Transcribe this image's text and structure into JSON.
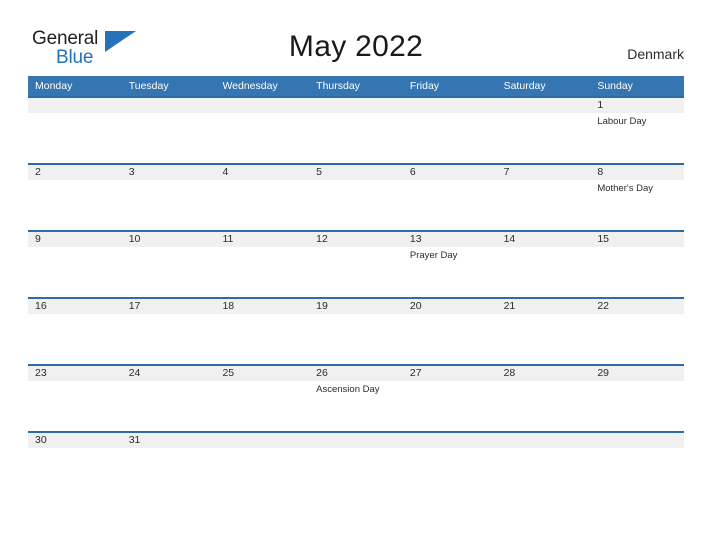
{
  "brand": {
    "name_primary": "General",
    "name_secondary": "Blue",
    "triangle_icon": "triangle-icon"
  },
  "header": {
    "title": "May 2022",
    "country": "Denmark"
  },
  "colors": {
    "header_blue": "#3575b2",
    "row_separator_blue": "#2e6da4",
    "number_band_gray": "#f0f0f0",
    "logo_blue": "#2572b8",
    "text_dark": "#2b2b2b"
  },
  "calendar": {
    "weekdays": [
      "Monday",
      "Tuesday",
      "Wednesday",
      "Thursday",
      "Friday",
      "Saturday",
      "Sunday"
    ],
    "weeks": [
      {
        "days": [
          {
            "number": "",
            "event": ""
          },
          {
            "number": "",
            "event": ""
          },
          {
            "number": "",
            "event": ""
          },
          {
            "number": "",
            "event": ""
          },
          {
            "number": "",
            "event": ""
          },
          {
            "number": "",
            "event": ""
          },
          {
            "number": "1",
            "event": "Labour Day"
          }
        ]
      },
      {
        "days": [
          {
            "number": "2",
            "event": ""
          },
          {
            "number": "3",
            "event": ""
          },
          {
            "number": "4",
            "event": ""
          },
          {
            "number": "5",
            "event": ""
          },
          {
            "number": "6",
            "event": ""
          },
          {
            "number": "7",
            "event": ""
          },
          {
            "number": "8",
            "event": "Mother's Day"
          }
        ]
      },
      {
        "days": [
          {
            "number": "9",
            "event": ""
          },
          {
            "number": "10",
            "event": ""
          },
          {
            "number": "11",
            "event": ""
          },
          {
            "number": "12",
            "event": ""
          },
          {
            "number": "13",
            "event": "Prayer Day"
          },
          {
            "number": "14",
            "event": ""
          },
          {
            "number": "15",
            "event": ""
          }
        ]
      },
      {
        "days": [
          {
            "number": "16",
            "event": ""
          },
          {
            "number": "17",
            "event": ""
          },
          {
            "number": "18",
            "event": ""
          },
          {
            "number": "19",
            "event": ""
          },
          {
            "number": "20",
            "event": ""
          },
          {
            "number": "21",
            "event": ""
          },
          {
            "number": "22",
            "event": ""
          }
        ]
      },
      {
        "days": [
          {
            "number": "23",
            "event": ""
          },
          {
            "number": "24",
            "event": ""
          },
          {
            "number": "25",
            "event": ""
          },
          {
            "number": "26",
            "event": "Ascension Day"
          },
          {
            "number": "27",
            "event": ""
          },
          {
            "number": "28",
            "event": ""
          },
          {
            "number": "29",
            "event": ""
          }
        ]
      },
      {
        "days": [
          {
            "number": "30",
            "event": ""
          },
          {
            "number": "31",
            "event": ""
          },
          {
            "number": "",
            "event": ""
          },
          {
            "number": "",
            "event": ""
          },
          {
            "number": "",
            "event": ""
          },
          {
            "number": "",
            "event": ""
          },
          {
            "number": "",
            "event": ""
          }
        ]
      }
    ]
  }
}
